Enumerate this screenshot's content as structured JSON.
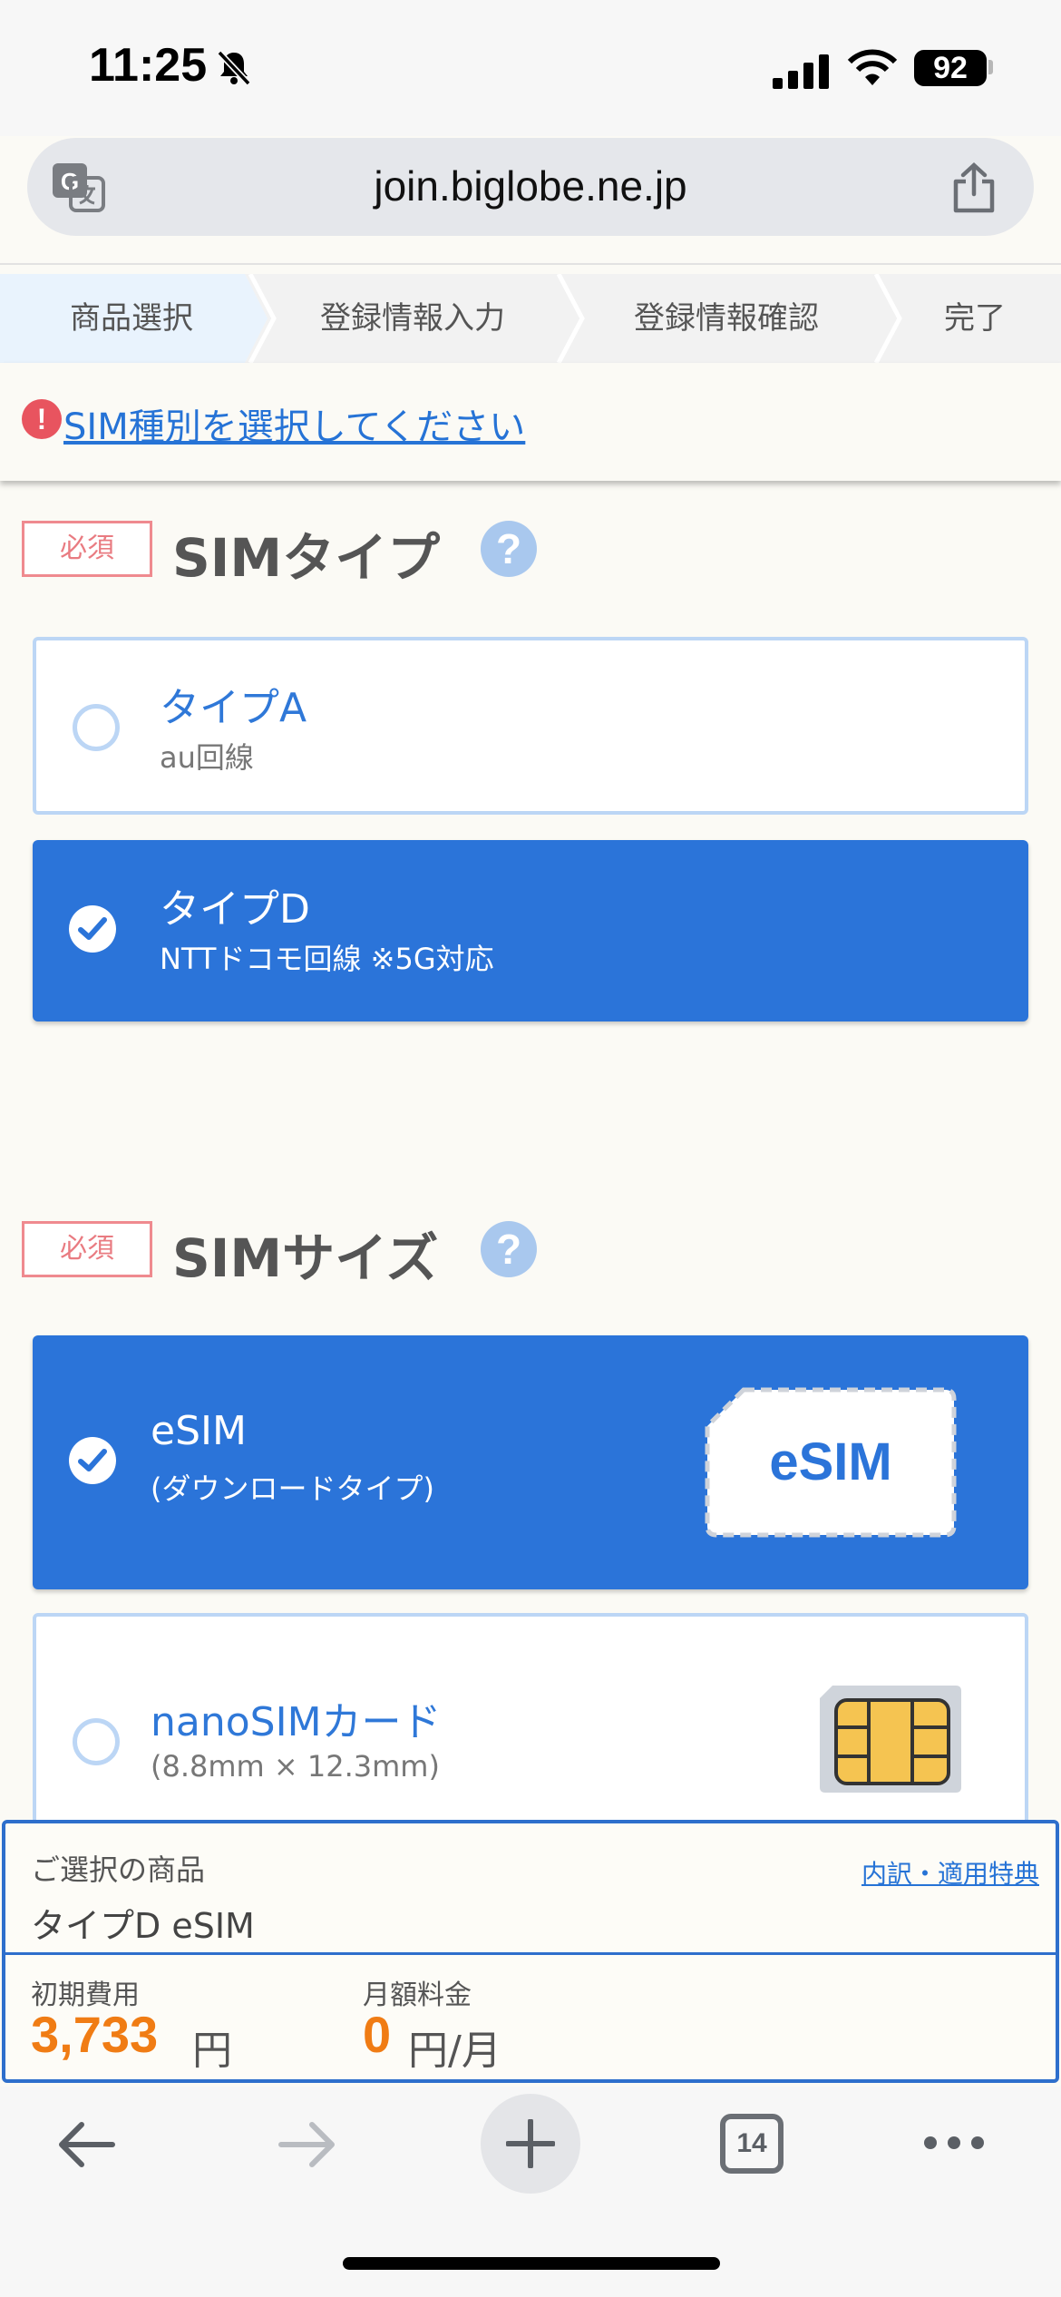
{
  "status_bar": {
    "time": "11:25",
    "battery": "92"
  },
  "browser": {
    "url": "join.biglobe.ne.jp",
    "tab_count": "14"
  },
  "steps": [
    "商品選択",
    "登録情報入力",
    "登録情報確認",
    "完了"
  ],
  "error_link": "SIM種別を選択してください",
  "sim_type": {
    "required": "必須",
    "title": "SIMタイプ",
    "help": "?",
    "options": [
      {
        "title": "タイプA",
        "sub": "au回線",
        "selected": false
      },
      {
        "title": "タイプD",
        "sub": "NTTドコモ回線 ※5G対応",
        "selected": true
      }
    ]
  },
  "sim_size": {
    "required": "必須",
    "title": "SIMサイズ",
    "help": "?",
    "options": [
      {
        "title": "eSIM",
        "sub": "(ダウンロードタイプ)",
        "badge": "eSIM",
        "selected": true
      },
      {
        "title": "nanoSIMカード",
        "sub": "(8.8mm × 12.3mm)",
        "selected": false
      }
    ]
  },
  "summary": {
    "label": "ご選択の商品",
    "link": "内訳・適用特典",
    "product": "タイプD eSIM",
    "initial_label": "初期費用",
    "initial_value": "3,733",
    "initial_unit": "円",
    "monthly_label": "月額料金",
    "monthly_value": "0",
    "monthly_unit": "円/月"
  },
  "colors": {
    "primary": "#2b74d9",
    "accent": "#f07c14",
    "error": "#e8545f"
  },
  "icons": [
    "bell-slash-icon",
    "cellular-signal-icon",
    "wifi-icon",
    "translate-icon",
    "share-icon",
    "back-arrow-icon",
    "forward-arrow-icon",
    "plus-icon",
    "more-icon"
  ]
}
